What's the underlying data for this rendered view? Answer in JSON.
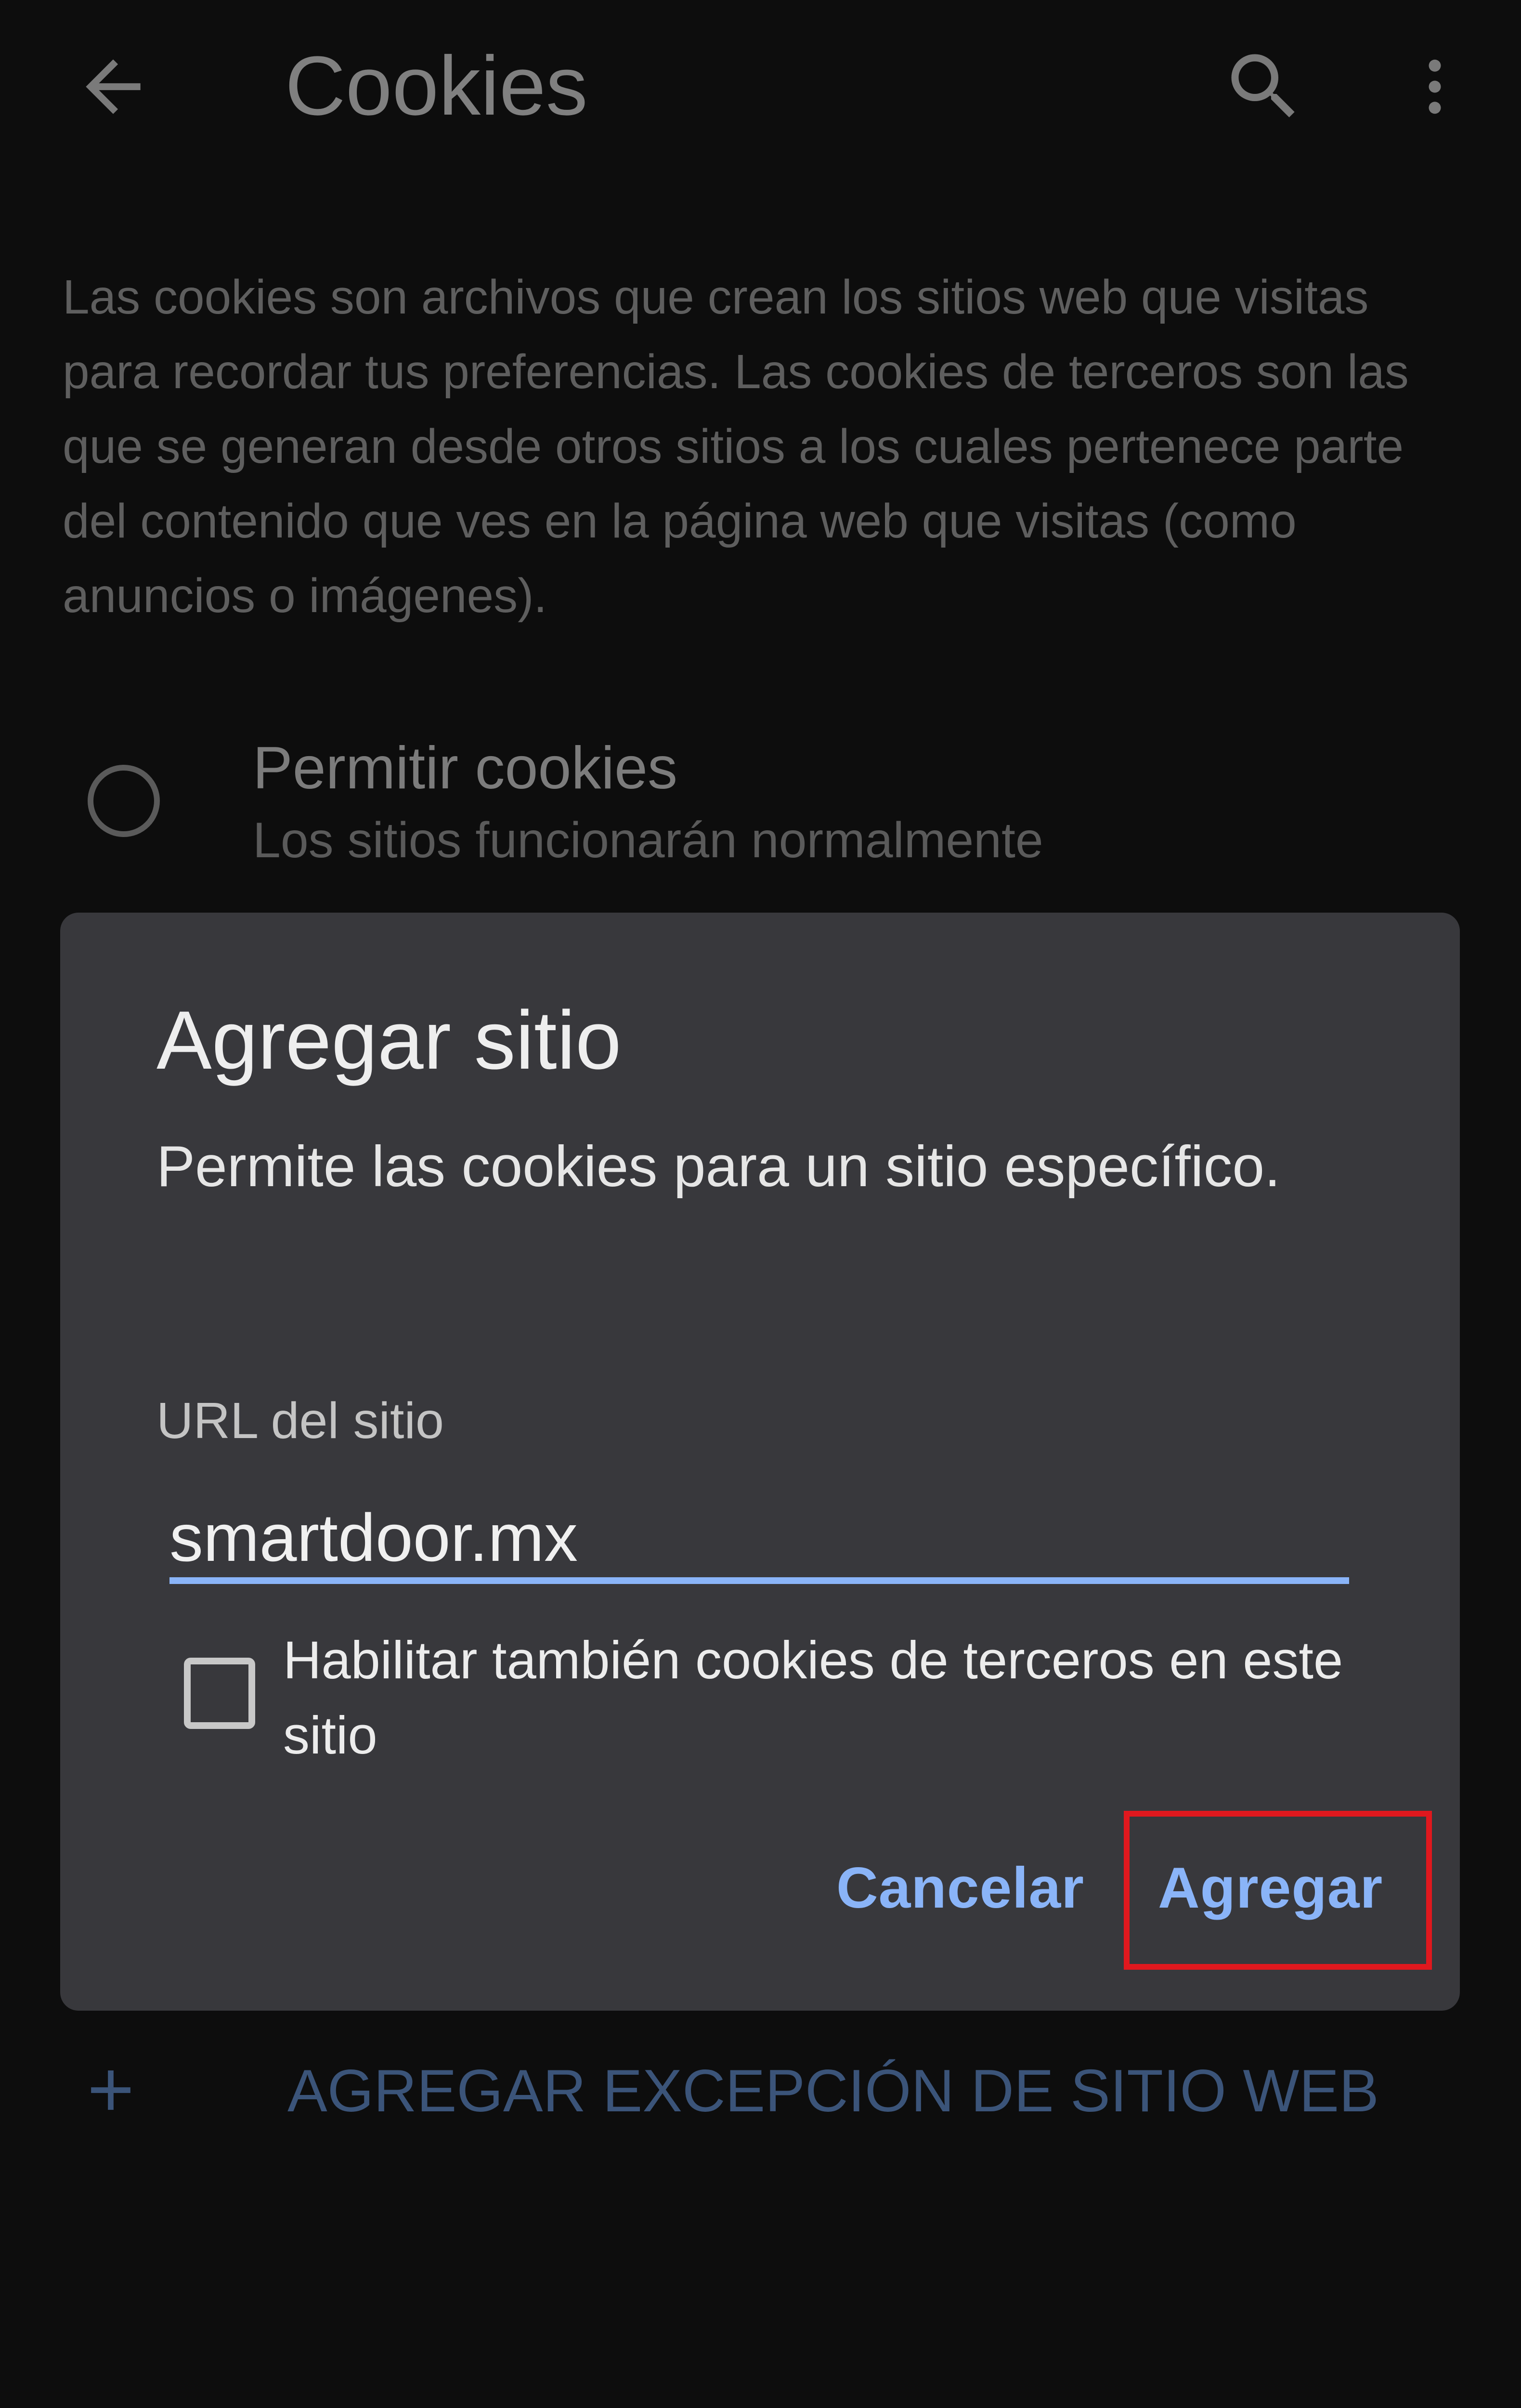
{
  "app_bar": {
    "title": "Cookies",
    "icons": [
      "arrow-back-icon",
      "search-icon",
      "more-vert-icon"
    ]
  },
  "description": "Las cookies son archivos que crean los sitios web que visitas para recordar tus preferencias. Las cookies de terceros son las que se generan desde otros sitios a los cuales pertenece parte del contenido que ves en la página web que visitas (como anuncios o imágenes).",
  "option": {
    "title": "Permitir cookies",
    "subtitle": "Los sitios funcionarán normalmente",
    "selected": false
  },
  "add_exception": {
    "label": "AGREGAR EXCEPCIÓN DE SITIO WEB"
  },
  "dialog": {
    "title": "Agregar sitio",
    "message": "Permite las cookies para un sitio específico.",
    "field_label": "URL del sitio",
    "url_value": "smartdoor.mx",
    "checkbox_label": "Habilitar también cookies de terceros en este sitio",
    "checkbox_checked": false,
    "cancel_label": "Cancelar",
    "confirm_label": "Agregar"
  },
  "colors": {
    "background": "#0d0d0d",
    "dialog_surface": "#38383c",
    "accent": "#8ab4f8",
    "highlight": "#e0181e"
  }
}
